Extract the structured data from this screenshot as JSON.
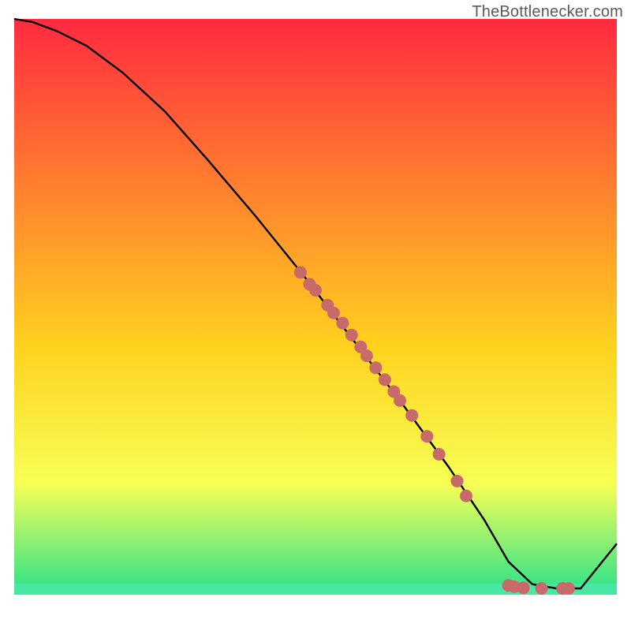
{
  "attribution": "TheBottlenecker.com",
  "chart_data": {
    "type": "line",
    "title": "",
    "xlabel": "",
    "ylabel": "",
    "xlim": [
      0,
      100
    ],
    "ylim": [
      0,
      100
    ],
    "background_gradient": {
      "top": "#ff2a40",
      "mid1": "#ffd21f",
      "mid2": "#f7ff55",
      "bottom": "#2fe28a",
      "baseline": "#ffffff"
    },
    "band_thin": {
      "from_y": 3.5,
      "to_y": 5.0,
      "color": "#48e7a2"
    },
    "curve": {
      "name": "bottleneck-curve",
      "x": [
        0,
        3,
        7,
        12,
        18,
        25,
        32,
        40,
        48,
        56,
        64,
        72,
        78,
        82,
        86,
        90,
        94,
        100
      ],
      "y": [
        100,
        99.5,
        98,
        95.5,
        91,
        84.5,
        76.5,
        67,
        57,
        46.5,
        36,
        25,
        16,
        9,
        5.2,
        4.5,
        4.5,
        12
      ]
    },
    "scatter": {
      "name": "scatter-points",
      "color": "#c86a6a",
      "radius": 8,
      "points": [
        {
          "x": 47.5,
          "y": 57.5
        },
        {
          "x": 49.0,
          "y": 55.5
        },
        {
          "x": 50.0,
          "y": 54.5
        },
        {
          "x": 52.0,
          "y": 52.0
        },
        {
          "x": 53.0,
          "y": 50.7
        },
        {
          "x": 54.5,
          "y": 49.0
        },
        {
          "x": 56.0,
          "y": 47.0
        },
        {
          "x": 57.5,
          "y": 45.0
        },
        {
          "x": 58.5,
          "y": 43.5
        },
        {
          "x": 60.0,
          "y": 41.5
        },
        {
          "x": 61.5,
          "y": 39.5
        },
        {
          "x": 63.0,
          "y": 37.5
        },
        {
          "x": 64.0,
          "y": 36.0
        },
        {
          "x": 66.0,
          "y": 33.5
        },
        {
          "x": 68.5,
          "y": 30.0
        },
        {
          "x": 70.5,
          "y": 27.0
        },
        {
          "x": 73.5,
          "y": 22.5
        },
        {
          "x": 75.0,
          "y": 20.0
        },
        {
          "x": 82.0,
          "y": 5.0
        },
        {
          "x": 83.0,
          "y": 4.8
        },
        {
          "x": 84.5,
          "y": 4.6
        },
        {
          "x": 87.5,
          "y": 4.5
        },
        {
          "x": 91.0,
          "y": 4.5
        },
        {
          "x": 92.0,
          "y": 4.5
        }
      ]
    }
  }
}
